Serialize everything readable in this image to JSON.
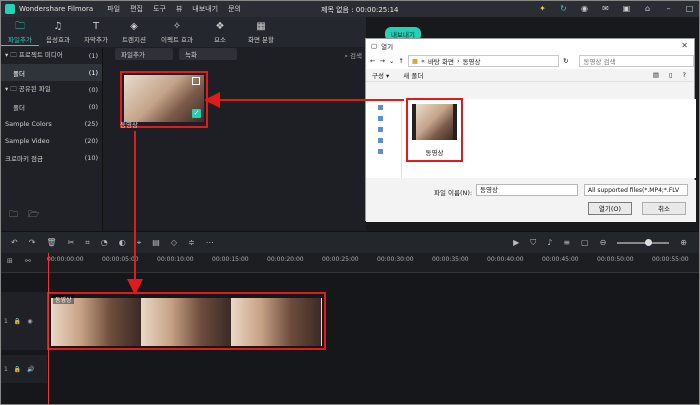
{
  "app": {
    "name": "Wondershare Filmora",
    "doc_title": "제목 없음 : 00:00:25:14"
  },
  "menu": [
    "파일",
    "편집",
    "도구",
    "뷰",
    "내보내기",
    "문의"
  ],
  "toolbar": [
    {
      "label": "파일추가",
      "icon": "folder-icon",
      "active": true
    },
    {
      "label": "음성효과",
      "icon": "music-icon",
      "active": false
    },
    {
      "label": "자막추가",
      "icon": "text-icon",
      "active": false
    },
    {
      "label": "트랜지션",
      "icon": "transition-icon",
      "active": false
    },
    {
      "label": "이펙트 효과",
      "icon": "effects-icon",
      "active": false
    },
    {
      "label": "요소",
      "icon": "elements-icon",
      "active": false
    },
    {
      "label": "화면 분할",
      "icon": "split-screen-icon",
      "active": false
    }
  ],
  "sidebar": {
    "items": [
      {
        "label": "▾ 🗀 프로젝트 미디어",
        "count": "(1)"
      },
      {
        "label": "폴더",
        "count": "(1)"
      },
      {
        "label": "▾ 🗀 공유된 파일",
        "count": "(0)"
      },
      {
        "label": "폴더",
        "count": "(0)"
      },
      {
        "label": "Sample Colors",
        "count": "(25)"
      },
      {
        "label": "Sample Video",
        "count": "(20)"
      },
      {
        "label": "크로마키 점금",
        "count": "(10)"
      }
    ]
  },
  "media": {
    "import_label": "파일추가",
    "record_label": "녹화",
    "search_label": "검색",
    "thumb_label": "동영상"
  },
  "export_label": "내보내기",
  "dialog": {
    "title": "열기",
    "path_prefix": "«",
    "path": "바탕 화면",
    "path_sep": "›",
    "folder": "동영상",
    "search_placeholder": "동영상 검색",
    "organize": "구성 ▾",
    "new_folder": "새 폴더",
    "file_label": "동영상",
    "filename_label": "파일 이름(N):",
    "filename_value": "동영상",
    "filetype": "All supported files(*.MP4;*.FLV",
    "open_button": "열기(O)",
    "cancel_button": "취소"
  },
  "ruler": [
    "00:00:00:00",
    "00:00:05:00",
    "00:00:10:00",
    "00:00:15:00",
    "00:00:20:00",
    "00:00:25:00",
    "00:00:30:00",
    "00:00:35:00",
    "00:00:40:00",
    "00:00:45:00",
    "00:00:50:00",
    "00:00:55:00"
  ],
  "timeline": {
    "clip_label": "동영상",
    "video_track": "1",
    "audio_track": "1"
  },
  "highlight_color": "#e11b1b",
  "accent_color": "#25d0b4"
}
